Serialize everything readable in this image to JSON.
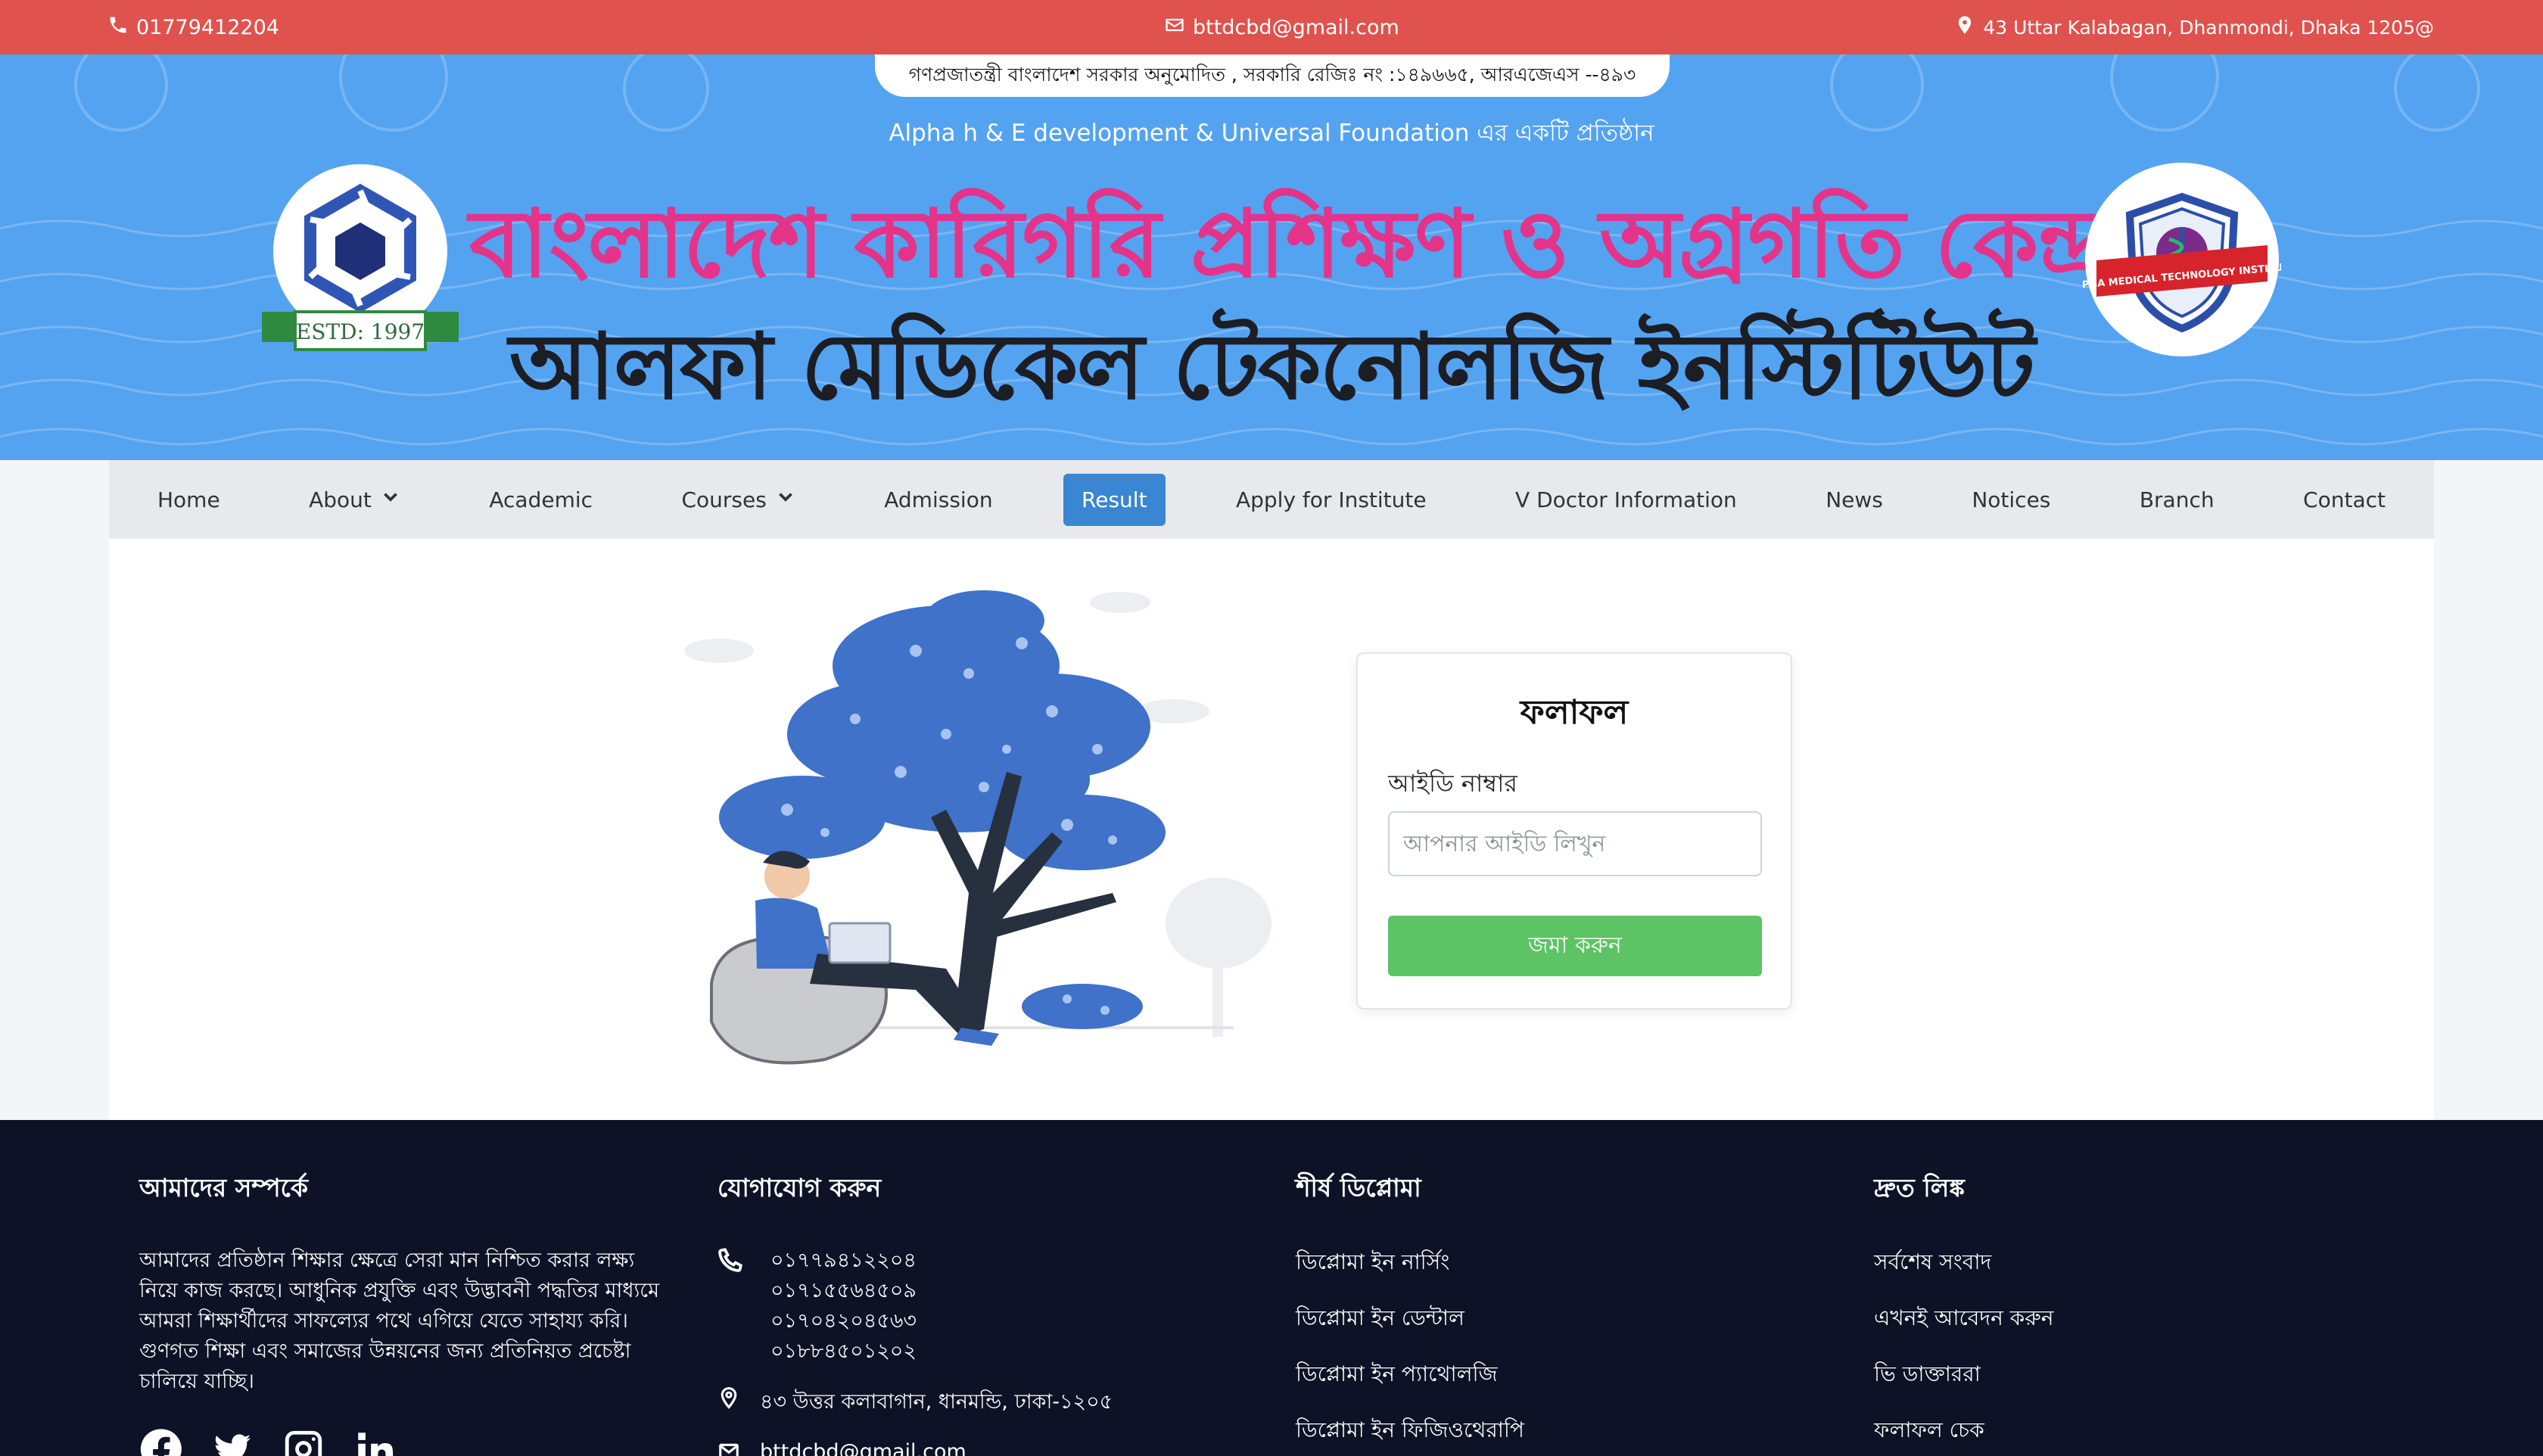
{
  "topbar": {
    "phone": "01779412204",
    "email": "bttdcbd@gmail.com",
    "address": "43 Uttar Kalabagan, Dhanmondi, Dhaka 1205@"
  },
  "header": {
    "registration": "গণপ্রজাতন্ত্রী বাংলাদেশ সরকার অনুমোদিত , সরকারি রেজিঃ নং :১৪৯৬৬৫, আরএজেএস --৪৯৩",
    "subtitle": "Alpha h & E development & Universal Foundation এর একটি প্রতিষ্ঠান",
    "title_line1": "বাংলাদেশ কারিগরি প্রশিক্ষণ ও অগ্রগতি কেন্দ্র",
    "title_line2": "আলফা মেডিকেল টেকনোলজি ইনস্টিটিউট",
    "left_logo_text": "ESTD: 1997",
    "right_logo_text": "ALPHA MEDICAL TECHNOLOGY INSTITUTE"
  },
  "nav": {
    "items": [
      {
        "label": "Home"
      },
      {
        "label": "About"
      },
      {
        "label": "Academic"
      },
      {
        "label": "Courses"
      },
      {
        "label": "Admission"
      },
      {
        "label": "Result"
      },
      {
        "label": "Apply for Institute"
      },
      {
        "label": "V Doctor Information"
      },
      {
        "label": "News"
      },
      {
        "label": "Notices"
      },
      {
        "label": "Branch"
      },
      {
        "label": "Contact"
      }
    ],
    "active": "Result"
  },
  "result_form": {
    "title": "ফলাফল",
    "id_label": "আইডি নাম্বার",
    "id_placeholder": "আপনার আইডি লিখুন",
    "submit_label": "জমা করুন"
  },
  "footer": {
    "about": {
      "heading": "আমাদের সম্পর্কে",
      "text": "আমাদের প্রতিষ্ঠান শিক্ষার ক্ষেত্রে সেরা মান নিশ্চিত করার লক্ষ্য নিয়ে কাজ করছে। আধুনিক প্রযুক্তি এবং উদ্ভাবনী পদ্ধতির মাধ্যমে আমরা শিক্ষার্থীদের সাফল্যের পথে এগিয়ে যেতে সাহায্য করি। গুণগত শিক্ষা এবং সমাজের উন্নয়নের জন্য প্রতিনিয়ত প্রচেষ্টা চালিয়ে যাচ্ছি।"
    },
    "contact": {
      "heading": "যোগাযোগ করুন",
      "phones": [
        "০১৭৭৯৪১২২০৪",
        "০১৭১৫৫৬৪৫০৯",
        "০১৭০৪২০৪৫৬৩",
        "০১৮৮৪৫০১২০২"
      ],
      "address": "৪৩ উত্তর কলাবাগান, ধানমন্ডি, ঢাকা-১২০৫",
      "email": "bttdcbd@gmail.com"
    },
    "diplomas": {
      "heading": "শীর্ষ ডিপ্লোমা",
      "items": [
        "ডিপ্লোমা ইন নার্সিং",
        "ডিপ্লোমা ইন ডেন্টাল",
        "ডিপ্লোমা ইন প্যাথোলজি",
        "ডিপ্লোমা ইন ফিজিওথেরাপি"
      ]
    },
    "quick_links": {
      "heading": "দ্রুত লিঙ্ক",
      "items": [
        "সর্বশেষ সংবাদ",
        "এখনই আবেদন করুন",
        "ভি ডাক্তাররা",
        "ফলাফল চেক"
      ]
    }
  },
  "colors": {
    "topbar": "#e0524d",
    "banner": "#54a3f1",
    "title_pink": "#e3348a",
    "active_nav": "#3a86d3",
    "submit": "#5cc464",
    "footer": "#0d1226"
  },
  "icons": [
    "phone-icon",
    "envelope-icon",
    "map-pin-icon",
    "chevron-down-icon",
    "facebook-icon",
    "twitter-icon",
    "instagram-icon",
    "linkedin-icon"
  ]
}
